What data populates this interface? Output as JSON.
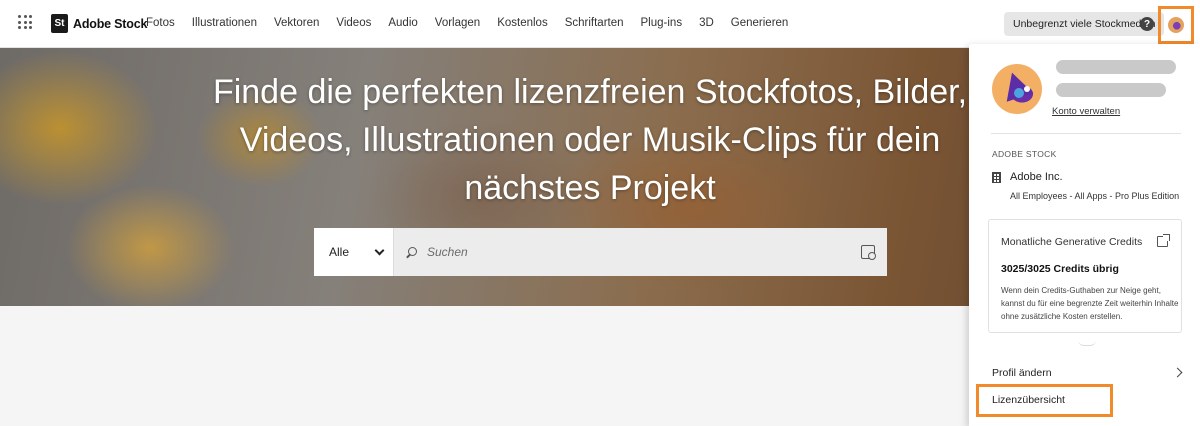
{
  "app": {
    "brand_logo": "St",
    "brand_name": "Adobe Stock"
  },
  "nav": {
    "items": [
      "Fotos",
      "Illustrationen",
      "Vektoren",
      "Videos",
      "Audio",
      "Vorlagen",
      "Kostenlos",
      "Schriftarten",
      "Plug-ins",
      "3D",
      "Generieren"
    ]
  },
  "header": {
    "unlimited_label": "Unbegrenzt viele Stockmedien",
    "help_label": "?"
  },
  "hero": {
    "title": "Finde die perfekten lizenzfreien Stockfotos, Bilder, Videos, Illustrationen oder Musik-Clips für dein nächstes Projekt"
  },
  "search": {
    "category": "Alle",
    "placeholder": "Suchen"
  },
  "profile_panel": {
    "manage_account": "Konto verwalten",
    "section_label": "ADOBE STOCK",
    "org_name": "Adobe Inc.",
    "org_plan": "All Employees - All Apps - Pro Plus Edition",
    "credits": {
      "title": "Monatliche Generative Credits",
      "count": "3025/3025 Credits übrig",
      "description": "Wenn dein Credits-Guthaben zur Neige geht, kannst du für eine begrenzte Zeit weiterhin Inhalte ohne zusätzliche Kosten erstellen."
    },
    "edit_profile": "Profil ändern",
    "license_overview": "Lizenzübersicht"
  },
  "colors": {
    "highlight": "#f08a2b"
  }
}
